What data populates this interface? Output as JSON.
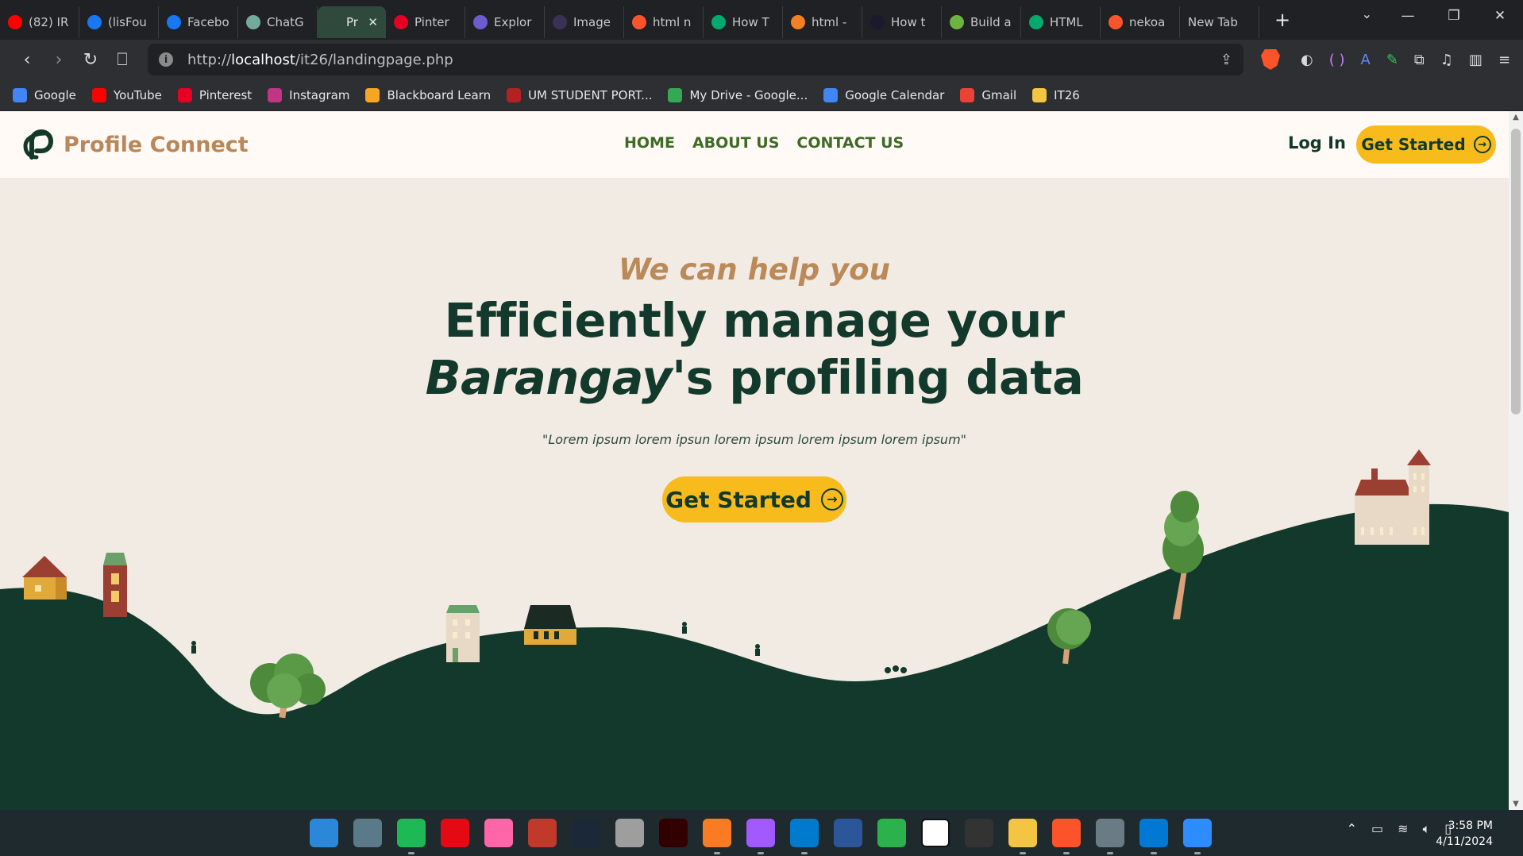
{
  "browser": {
    "tabs": [
      {
        "title": "(82) IR",
        "favicon": "youtube-icon",
        "color": "#ff0000"
      },
      {
        "title": "(lisFou",
        "favicon": "facebook-icon",
        "color": "#1877f2"
      },
      {
        "title": "Facebo",
        "favicon": "facebook-icon",
        "color": "#1877f2"
      },
      {
        "title": "ChatG",
        "favicon": "chatgpt-icon",
        "color": "#74aa9c"
      },
      {
        "title": "Pr",
        "favicon": "profile-connect-icon",
        "color": "#2f4a3c",
        "active": true
      },
      {
        "title": "Pinter",
        "favicon": "pinterest-icon",
        "color": "#e60023"
      },
      {
        "title": "Explor",
        "favicon": "explore-icon",
        "color": "#6d5bd0"
      },
      {
        "title": "Image",
        "favicon": "b-icon",
        "color": "#3b3157"
      },
      {
        "title": "html n",
        "favicon": "brave-icon",
        "color": "#fb542b"
      },
      {
        "title": "How T",
        "favicon": "w3schools-icon",
        "color": "#04aa6d"
      },
      {
        "title": "html -",
        "favicon": "stackoverflow-icon",
        "color": "#f48024"
      },
      {
        "title": "How t",
        "favicon": "code-icon",
        "color": "#1a1a2e"
      },
      {
        "title": "Build a",
        "favicon": "leaf-icon",
        "color": "#6db33f"
      },
      {
        "title": "HTML",
        "favicon": "w3schools-icon",
        "color": "#04aa6d"
      },
      {
        "title": "nekoa",
        "favicon": "brave-icon",
        "color": "#fb542b"
      },
      {
        "title": "New Tab",
        "favicon": "",
        "color": ""
      }
    ],
    "url_prefix": "http://",
    "url_host": "localhost",
    "url_path": "/it26/landingpage.php",
    "bookmarks": [
      {
        "label": "Google",
        "icon": "google-icon",
        "color": "#4285f4"
      },
      {
        "label": "YouTube",
        "icon": "youtube-icon",
        "color": "#ff0000"
      },
      {
        "label": "Pinterest",
        "icon": "pinterest-icon",
        "color": "#e60023"
      },
      {
        "label": "Instagram",
        "icon": "instagram-icon",
        "color": "#c13584"
      },
      {
        "label": "Blackboard Learn",
        "icon": "blackboard-icon",
        "color": "#f5a623"
      },
      {
        "label": "UM STUDENT PORT...",
        "icon": "um-icon",
        "color": "#b22222"
      },
      {
        "label": "My Drive - Google...",
        "icon": "drive-icon",
        "color": "#34a853"
      },
      {
        "label": "Google Calendar",
        "icon": "calendar-icon",
        "color": "#4285f4"
      },
      {
        "label": "Gmail",
        "icon": "gmail-icon",
        "color": "#ea4335"
      },
      {
        "label": "IT26",
        "icon": "folder-icon",
        "color": "#f4c542"
      }
    ]
  },
  "site": {
    "brand": "Profile Connect",
    "nav": [
      "HOME",
      "ABOUT US",
      "CONTACT US"
    ],
    "login": "Log In",
    "cta": "Get Started",
    "colors": {
      "primary": "#12392b",
      "accent": "#f8bb1c",
      "brand_tan": "#b8875a",
      "nav_green": "#3e6b27",
      "background": "#f1ebe4"
    }
  },
  "hero": {
    "kicker": "We can help you",
    "title_line1": "Efficiently manage your",
    "title_em": "Barangay",
    "title_rest": "'s profiling data",
    "quote": "\"Lorem ipsum lorem ipsun lorem ipsum lorem ipsum lorem ipsum\"",
    "cta": "Get Started"
  },
  "taskbar": {
    "apps": [
      {
        "name": "start-icon",
        "color": "#2b88d8"
      },
      {
        "name": "search-app-icon",
        "color": "#5a7a8a"
      },
      {
        "name": "spotify-icon",
        "color": "#1db954",
        "running": true
      },
      {
        "name": "netflix-icon",
        "color": "#e50914"
      },
      {
        "name": "osu-icon",
        "color": "#ff66aa"
      },
      {
        "name": "game-icon",
        "color": "#c0392b"
      },
      {
        "name": "steam-icon",
        "color": "#1b2838"
      },
      {
        "name": "clip-studio-icon",
        "color": "#9e9e9e"
      },
      {
        "name": "illustrator-icon",
        "color": "#330000"
      },
      {
        "name": "xampp-icon",
        "color": "#fb7a24",
        "running": true
      },
      {
        "name": "figma-icon",
        "color": "#a259ff",
        "running": true
      },
      {
        "name": "vscode-icon",
        "color": "#007acc",
        "running": true
      },
      {
        "name": "word-icon",
        "color": "#2b579a"
      },
      {
        "name": "feedly-icon",
        "color": "#2bb24c"
      },
      {
        "name": "notion-icon",
        "color": "#ffffff"
      },
      {
        "name": "calendar-app-icon",
        "color": "#333333"
      },
      {
        "name": "file-explorer-icon",
        "color": "#f4c542",
        "running": true
      },
      {
        "name": "brave-icon",
        "color": "#fb542b",
        "running": true
      },
      {
        "name": "settings-icon",
        "color": "#6a7b86",
        "running": true
      },
      {
        "name": "store-icon",
        "color": "#0078d4",
        "running": true
      },
      {
        "name": "zoom-icon",
        "color": "#2d8cff",
        "running": true
      }
    ],
    "time": "3:58 PM",
    "date": "4/11/2024"
  }
}
